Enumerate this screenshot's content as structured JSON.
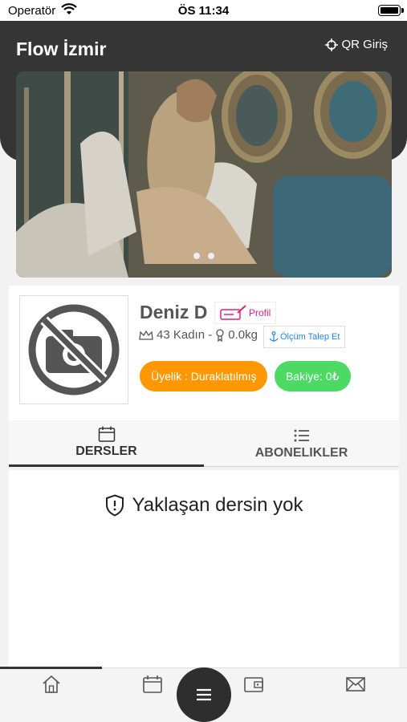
{
  "status_bar": {
    "carrier": "Operatör",
    "time": "ÖS 11:34"
  },
  "header": {
    "title": "Flow İzmir",
    "qr_label": "QR Giriş"
  },
  "banner": {
    "slide_count": 2,
    "active_slide": 1
  },
  "profile": {
    "name": "Deniz D",
    "profile_button_label": "Profil",
    "age_gender": "43 Kadın -",
    "weight": "0.0kg",
    "measurement_button_label": "Ölçüm Talep Et",
    "membership_badge": "Üyelik : Duraklatılmış",
    "balance_badge": "Bakiye: 0₺"
  },
  "tabs": [
    {
      "label": "DERSLER",
      "icon": "calendar-icon",
      "active": true
    },
    {
      "label": "ABONELIKLER",
      "icon": "list-icon",
      "active": false
    }
  ],
  "content": {
    "empty_message": "Yaklaşan dersin yok"
  },
  "bottom_nav": {
    "items": [
      {
        "name": "home",
        "icon": "home-icon"
      },
      {
        "name": "calendar",
        "icon": "calendar-icon"
      },
      {
        "name": "wallet",
        "icon": "wallet-icon"
      },
      {
        "name": "messages",
        "icon": "envelope-icon"
      }
    ],
    "fab_icon": "menu-icon"
  },
  "colors": {
    "header_bg": "#353535",
    "membership": "#ff9800",
    "balance": "#4cd964",
    "profile_accent": "#e91e7a",
    "measure_accent": "#1e88e5"
  }
}
